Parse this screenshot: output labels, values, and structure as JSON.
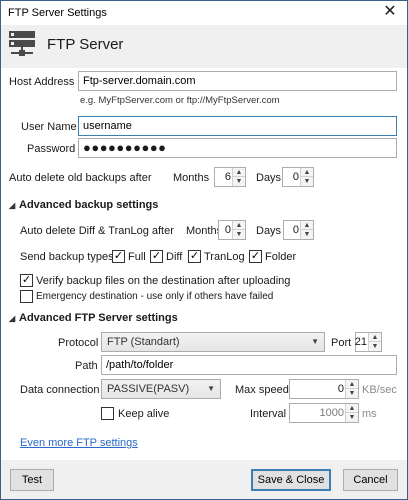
{
  "window": {
    "title": "FTP Server Settings",
    "close_glyph": "✕"
  },
  "header": {
    "title": "FTP Server",
    "icon": "server-icon"
  },
  "host": {
    "label": "Host Address",
    "value": "Ftp-server.domain.com",
    "hint": "e.g. MyFtpServer.com or ftp://MyFtpServer.com"
  },
  "user": {
    "label": "User Name",
    "value": "username"
  },
  "password": {
    "label": "Password",
    "masked": "●●●●●●●●●●"
  },
  "auto_delete": {
    "label": "Auto delete old backups after",
    "months_label": "Months",
    "months_value": "6",
    "days_label": "Days",
    "days_value": "0"
  },
  "advanced_backup": {
    "title": "Advanced backup settings",
    "diff_label": "Auto delete Diff & TranLog after",
    "months_label": "Months",
    "months_value": "0",
    "days_label": "Days",
    "days_value": "0",
    "send_types_label": "Send backup types",
    "types": [
      {
        "label": "Full",
        "checked": true
      },
      {
        "label": "Diff",
        "checked": true
      },
      {
        "label": "TranLog",
        "checked": true
      },
      {
        "label": "Folder",
        "checked": true
      }
    ],
    "verify_label": "Verify backup files on the destination after uploading",
    "verify_checked": true,
    "emergency_label": "Emergency destination - use only if others have failed",
    "emergency_checked": false
  },
  "advanced_ftp": {
    "title": "Advanced FTP Server settings",
    "protocol_label": "Protocol",
    "protocol_value": "FTP (Standart)",
    "port_label": "Port",
    "port_value": "21",
    "path_label": "Path",
    "path_value": "/path/to/folder",
    "data_connection_label": "Data connection",
    "data_connection_value": "PASSIVE(PASV)",
    "max_speed_label": "Max speed",
    "max_speed_value": "0",
    "max_speed_unit": "KB/sec",
    "keep_alive_label": "Keep alive",
    "keep_alive_checked": false,
    "interval_label": "Interval",
    "interval_value": "1000",
    "interval_unit": "ms"
  },
  "more_link": "Even more FTP settings",
  "footer": {
    "test_label": "Test",
    "save_label": "Save & Close",
    "cancel_label": "Cancel"
  },
  "check_glyph": "✓",
  "colors": {
    "accent": "#3c7fb1",
    "link": "#2a6ac8",
    "header_bg": "#f0f0f0"
  }
}
